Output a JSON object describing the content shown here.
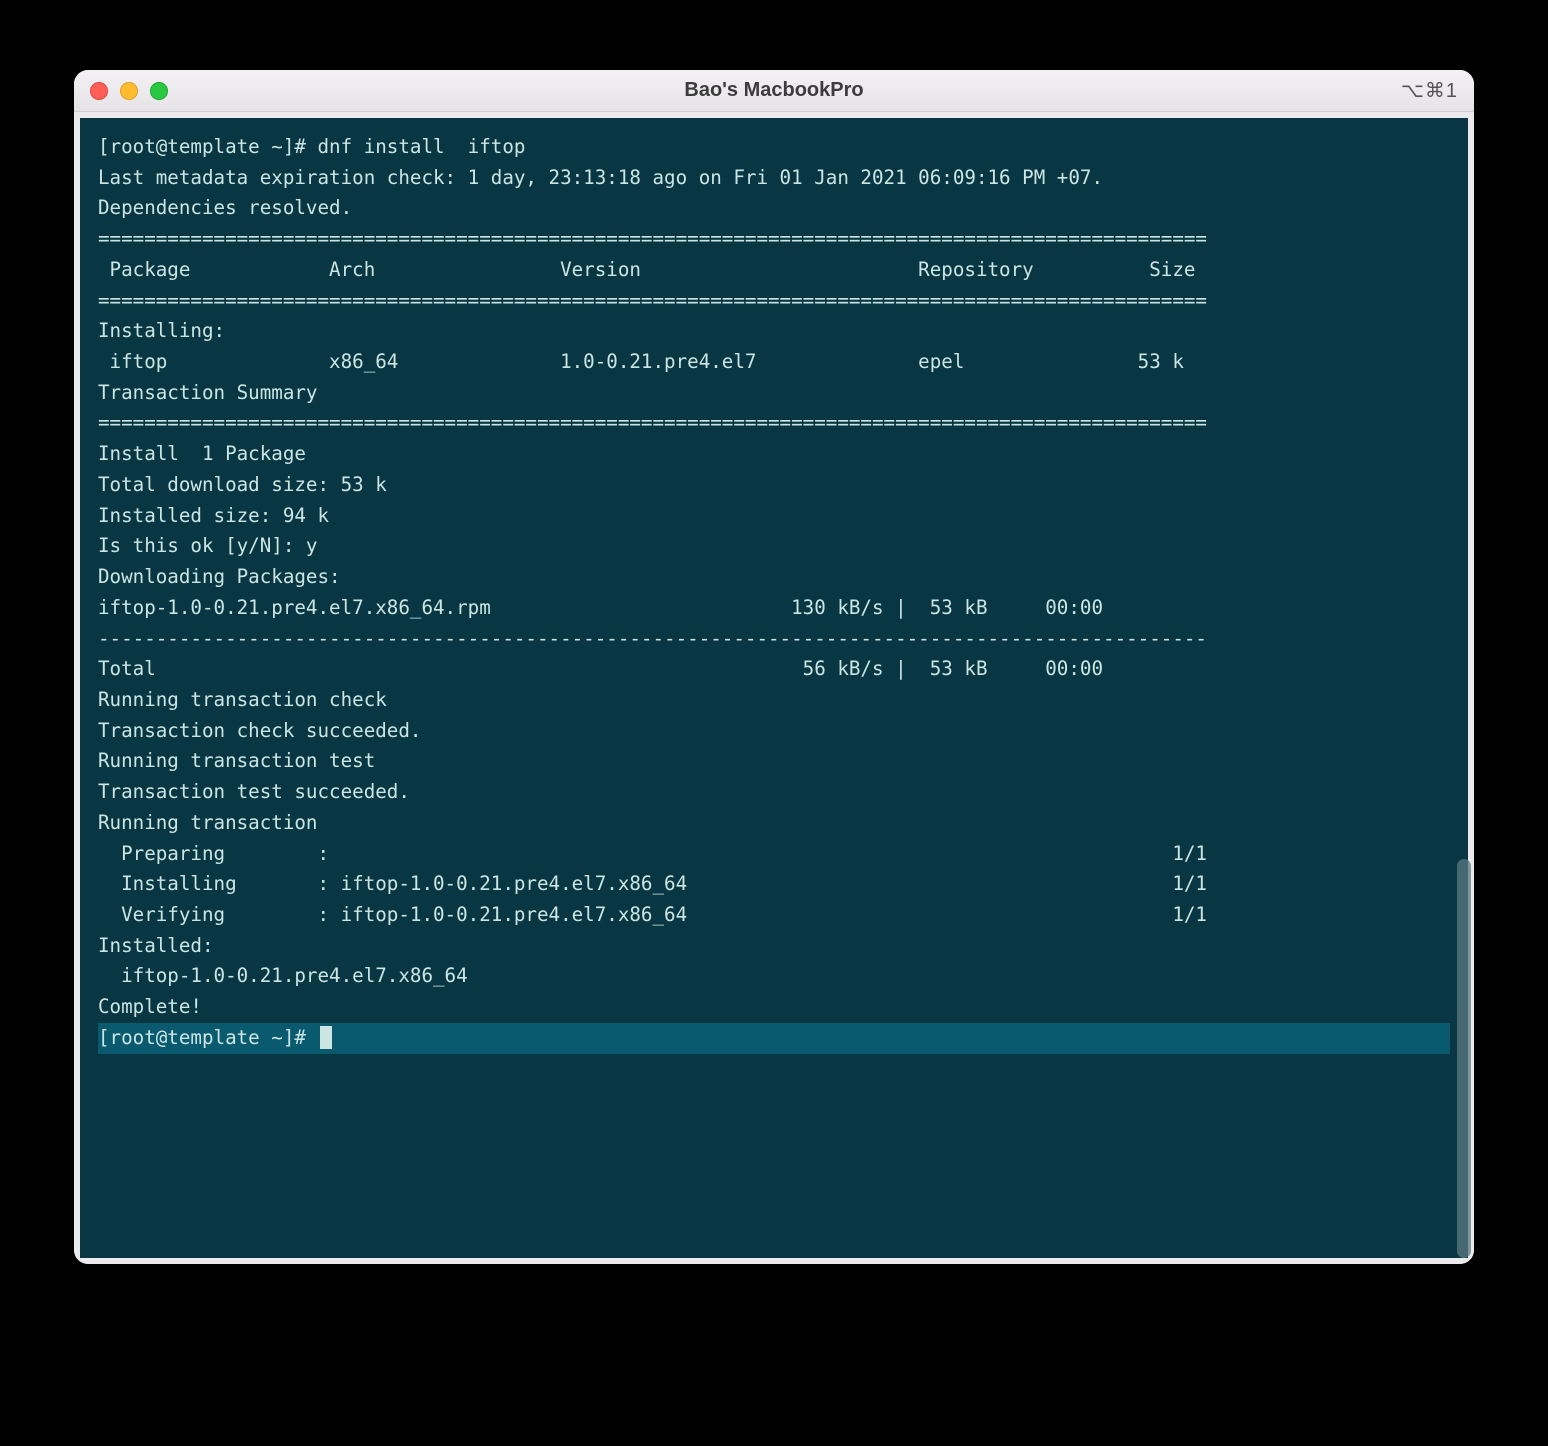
{
  "window": {
    "title": "Bao's MacbookPro",
    "hotkey": "⌥⌘1"
  },
  "term": {
    "l01": "[root@template ~]# dnf install  iftop",
    "l02": "Last metadata expiration check: 1 day, 23:13:18 ago on Fri 01 Jan 2021 06:09:16 PM +07.",
    "l03": "Dependencies resolved.",
    "l04": "================================================================================================",
    "l05": " Package            Arch                Version                        Repository          Size",
    "l06": "================================================================================================",
    "l07": "Installing:",
    "l08": " iftop              x86_64              1.0-0.21.pre4.el7              epel               53 k",
    "l09": "",
    "l10": "Transaction Summary",
    "l11": "================================================================================================",
    "l12": "Install  1 Package",
    "l13": "",
    "l14": "Total download size: 53 k",
    "l15": "Installed size: 94 k",
    "l16": "Is this ok [y/N]: y",
    "l17": "Downloading Packages:",
    "l18": "iftop-1.0-0.21.pre4.el7.x86_64.rpm                          130 kB/s |  53 kB     00:00",
    "l19": "------------------------------------------------------------------------------------------------",
    "l20": "Total                                                        56 kB/s |  53 kB     00:00",
    "l21": "Running transaction check",
    "l22": "Transaction check succeeded.",
    "l23": "Running transaction test",
    "l24": "Transaction test succeeded.",
    "l25": "Running transaction",
    "l26": "  Preparing        :                                                                         1/1",
    "l27": "  Installing       : iftop-1.0-0.21.pre4.el7.x86_64                                          1/1",
    "l28": "  Verifying        : iftop-1.0-0.21.pre4.el7.x86_64                                          1/1",
    "l29": "",
    "l30": "Installed:",
    "l31": "  iftop-1.0-0.21.pre4.el7.x86_64",
    "l32": "",
    "l33": "Complete!",
    "l34": "[root@template ~]# "
  }
}
